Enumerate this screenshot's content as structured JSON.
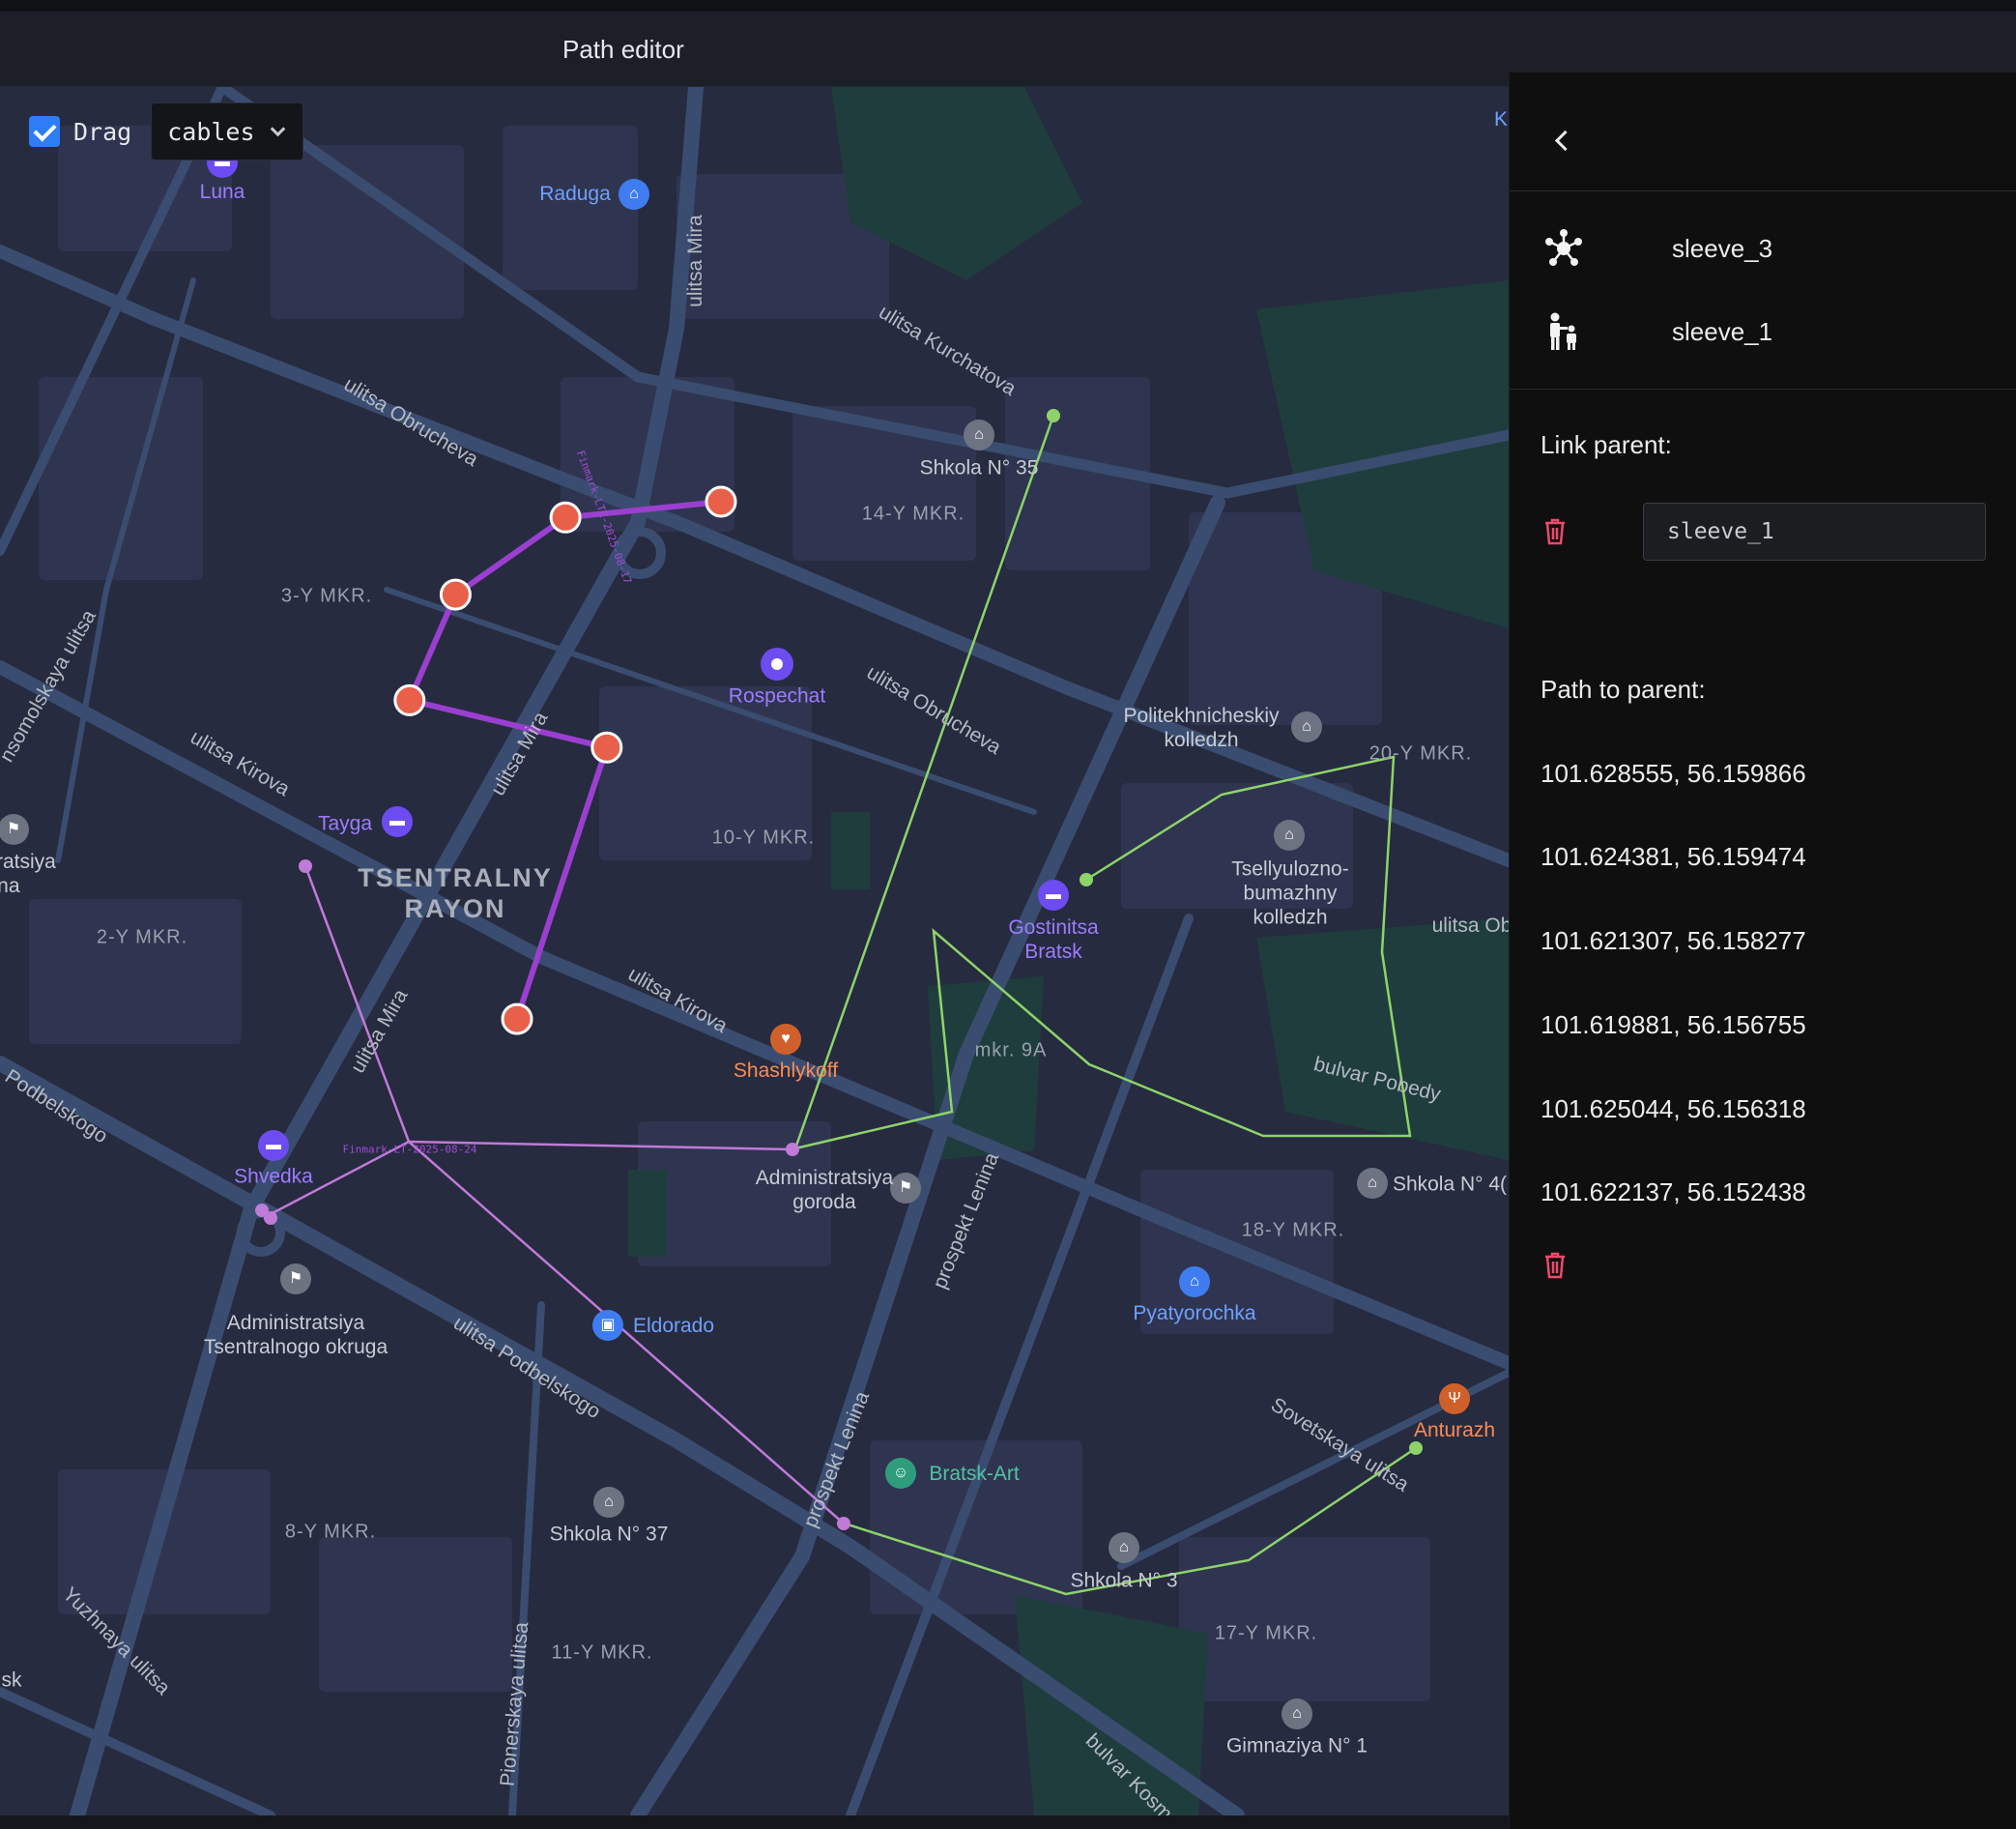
{
  "header": {
    "title": "Path editor"
  },
  "map": {
    "controls": {
      "drag_label": "Drag",
      "drag_checked": true,
      "layer_value": "cables"
    },
    "districts": [
      "3-Y MKR.",
      "14-Y MKR.",
      "10-Y MKR.",
      "2-Y MKR.",
      "20-Y MKR.",
      "18-Y MKR.",
      "8-Y MKR.",
      "11-Y MKR.",
      "17-Y MKR.",
      "mkr. 9A"
    ],
    "area_name": "TSENTRALNY RAYON",
    "streets": [
      "ulitsa Mira",
      "ulitsa Kurchatova",
      "ulitsa Obrucheva",
      "ulitsa Obrucheva",
      "nsomolskaya ulitsa",
      "ulitsa Kirova",
      "ulitsa Mira",
      "ulitsa Kirova",
      "ulitsa Mira",
      "Podbelskogo",
      "ulitsa Podbelskogo",
      "prospekt Lenina",
      "prospekt Lenina",
      "Sovetskaya ulitsa",
      "bulvar Pobedy",
      "Yuzhnaya ulitsa",
      "Pionerskaya ulitsa",
      "bulvar Kosmon",
      "ulitsa Ob"
    ],
    "pois": [
      "Luna",
      "Raduga",
      "Shkola N° 35",
      "Rospechat",
      "Politekhnicheskiy kolledzh",
      "Tayga",
      "istratsiya yona",
      "Tsellyulozno-bumazhny kolledzh",
      "Gostinitsa Bratsk",
      "Shashlykoff",
      "Administratsiya goroda",
      "Shvedka",
      "Shkola N° 4(",
      "Administratsiya Tsentralnogo okruga",
      "Eldorado",
      "Pyatyorochka",
      "Anturazh",
      "Bratsk-Art",
      "Shkola N° 37",
      "Shkola N° 3",
      "Gimnaziya N° 1",
      "sk",
      "K"
    ],
    "cable_labels": [
      "Finmark-LTE-2025-08-17",
      "Finmark-LT-2025-08-24"
    ],
    "colors": {
      "selected_path": "#9a3fd0",
      "vertex": "#e8604a",
      "purple_cable": "#c07ad8",
      "green_cable": "#8ed36a",
      "map_bg": "#262b3f",
      "road": "#3a4d70"
    }
  },
  "panel": {
    "nodes": [
      {
        "icon": "sleeve-cluster-icon",
        "label": "sleeve_3"
      },
      {
        "icon": "hierarchy-person-icon",
        "label": "sleeve_1"
      }
    ],
    "link_parent_label": "Link parent:",
    "link_parent_value": "sleeve_1",
    "path_label": "Path to parent:",
    "path_coordinates": [
      "101.628555, 56.159866",
      "101.624381, 56.159474",
      "101.621307, 56.158277",
      "101.619881, 56.156755",
      "101.625044, 56.156318",
      "101.622137, 56.152438"
    ],
    "delete_color": "#ee4a6a"
  }
}
